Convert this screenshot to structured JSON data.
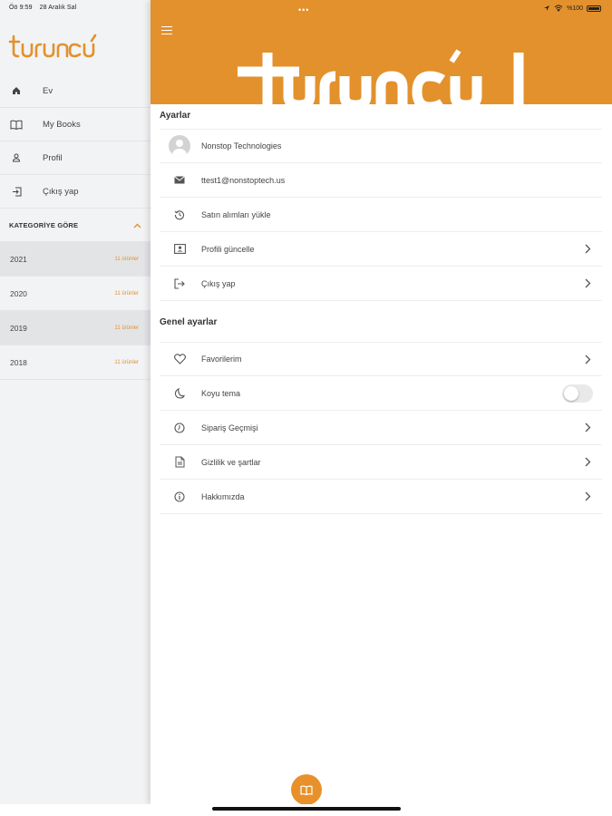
{
  "status": {
    "time": "Öö 9:59",
    "date": "28 Aralık Sal",
    "dots": "•••",
    "battery": "%100"
  },
  "sidebar": {
    "logo_text": "turuncu",
    "nav": [
      {
        "label": "Ev",
        "icon": "home-icon"
      },
      {
        "label": "My Books",
        "icon": "book-icon"
      },
      {
        "label": "Profil",
        "icon": "person-icon"
      },
      {
        "label": "Çıkış yap",
        "icon": "logout-icon"
      }
    ],
    "category_header": "KATEGORİYE GÖRE",
    "categories": [
      {
        "year": "2021",
        "count": "11 ürünler"
      },
      {
        "year": "2020",
        "count": "11 ürünler"
      },
      {
        "year": "2019",
        "count": "11 ürünler"
      },
      {
        "year": "2018",
        "count": "11 ürünler"
      }
    ]
  },
  "main": {
    "settings_title": "Ayarlar",
    "account": [
      {
        "label": "Nonstop Technologies",
        "icon": "avatar"
      },
      {
        "label": "ttest1@nonstoptech.us",
        "icon": "mail-icon"
      },
      {
        "label": "Satın alımları yükle",
        "icon": "history-icon"
      },
      {
        "label": "Profili güncelle",
        "icon": "profile-card-icon"
      },
      {
        "label": "Çıkış yap",
        "icon": "logout-icon"
      }
    ],
    "general_title": "Genel ayarlar",
    "general": [
      {
        "label": "Favorilerim",
        "icon": "heart-icon"
      },
      {
        "label": "Koyu tema",
        "icon": "moon-icon",
        "toggle": false
      },
      {
        "label": "Sipariş Geçmişi",
        "icon": "clock-icon"
      },
      {
        "label": "Gizlilik ve şartlar",
        "icon": "document-icon"
      },
      {
        "label": "Hakkımızda",
        "icon": "info-icon"
      }
    ]
  },
  "colors": {
    "accent": "#e3912c",
    "sidebar_bg": "#f2f3f5"
  }
}
